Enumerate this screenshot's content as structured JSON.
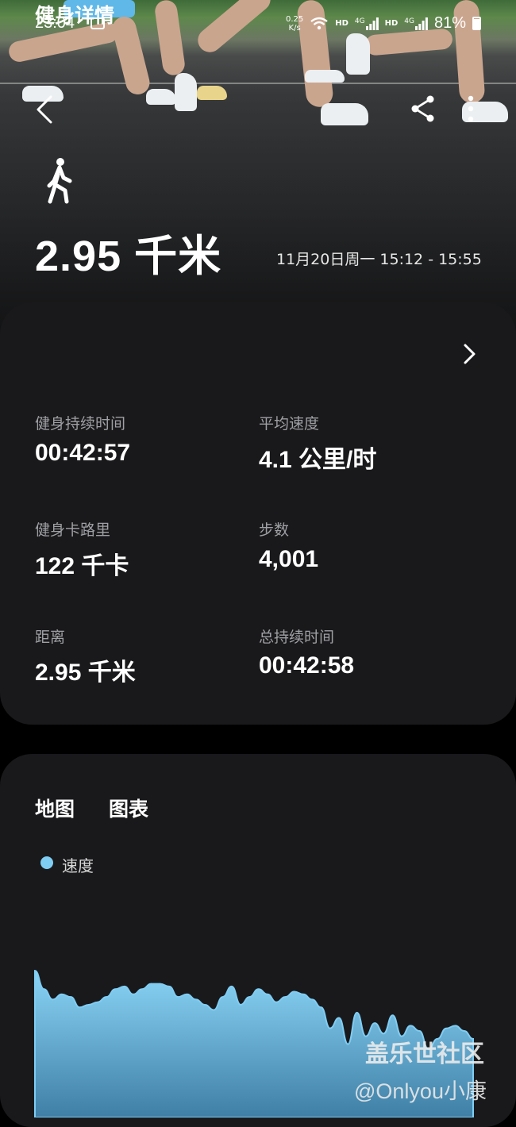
{
  "status_bar": {
    "time": "23:04",
    "net_speed_top": "0.25",
    "net_speed_unit": "K/s",
    "hd1": "HD",
    "sig1": "4G",
    "hd2": "HD",
    "sig2": "4G",
    "battery": "81%"
  },
  "header": {
    "back_icon": "chevron-left-icon",
    "share_icon": "share-icon",
    "more_icon": "more-vertical-icon",
    "activity_icon": "walking-icon"
  },
  "summary": {
    "distance": "2.95 千米",
    "date_range": "11月20日周一 15:12 - 15:55"
  },
  "details": {
    "title": "健身详情",
    "stats": [
      {
        "label": "健身持续时间",
        "value": "00:42:57"
      },
      {
        "label": "平均速度",
        "value": "4.1 公里/时"
      },
      {
        "label": "健身卡路里",
        "value": "122 千卡"
      },
      {
        "label": "步数",
        "value": "4,001"
      },
      {
        "label": "距离",
        "value": "2.95 千米"
      },
      {
        "label": "总持续时间",
        "value": "00:42:58"
      }
    ]
  },
  "chart_section": {
    "tabs": [
      "地图",
      "图表"
    ],
    "legend": "速度",
    "accent_color": "#7fcdf3"
  },
  "chart_data": {
    "type": "area",
    "title": "",
    "series": [
      {
        "name": "速度",
        "values": [
          5.6,
          4.9,
          4.5,
          4.7,
          4.6,
          4.2,
          4.3,
          4.4,
          4.6,
          4.9,
          5.0,
          4.7,
          4.9,
          5.1,
          5.1,
          5.0,
          4.6,
          4.7,
          4.5,
          4.3,
          4.1,
          4.6,
          5.0,
          4.3,
          4.6,
          4.9,
          4.7,
          4.4,
          4.6,
          4.8,
          4.7,
          4.5,
          4.2,
          3.4,
          3.8,
          2.8,
          4.0,
          3.1,
          3.6,
          3.2,
          3.9,
          3.1,
          3.5,
          3.3,
          2.6,
          3.0,
          3.4,
          3.5,
          3.3,
          3.0
        ]
      }
    ]
  },
  "watermark": {
    "line1": "盖乐世社区",
    "line2": "@Onlyou小康"
  }
}
